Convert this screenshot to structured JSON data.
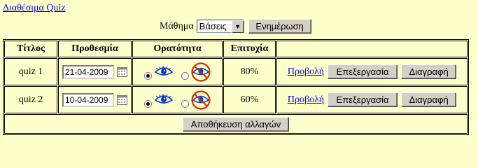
{
  "page": {
    "top_link": "Διαθέσιμα Quiz"
  },
  "filter": {
    "label": "Μάθημα",
    "selected": "Βάσεις",
    "refresh_label": "Ενημέρωση"
  },
  "table": {
    "headers": [
      "Τίτλος",
      "Προθεσμία",
      "Ορατότητα",
      "Επιτυχία",
      ""
    ],
    "rows": [
      {
        "title": "quiz 1",
        "deadline": "21-04-2009",
        "visible": true,
        "success": "80%"
      },
      {
        "title": "quiz 2",
        "deadline": "10-04-2009",
        "visible": true,
        "success": "60%"
      }
    ],
    "actions": {
      "view": "Προβολή",
      "edit": "Επεξεργασία",
      "delete": "Διαγραφή"
    },
    "save_label": "Αποθήκευση αλλαγών"
  },
  "colors": {
    "background": "#ffffcc",
    "link": "#0000ee",
    "button": "#d4d0c8",
    "no_entry": "#cc3300",
    "eye": "#0033cc"
  },
  "icons": [
    "calendar-icon",
    "eye-icon",
    "eye-hidden-icon",
    "chevron-down-icon"
  ]
}
